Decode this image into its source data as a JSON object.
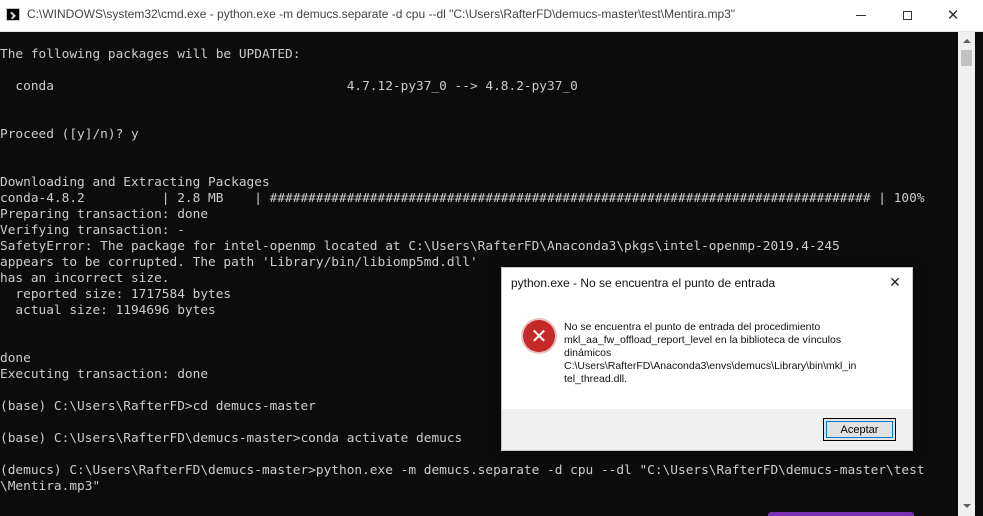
{
  "window": {
    "title": "C:\\WINDOWS\\system32\\cmd.exe - python.exe  -m demucs.separate -d cpu --dl \"C:\\Users\\RafterFD\\demucs-master\\test\\Mentira.mp3\"",
    "buttons": {
      "minimize": "minimize-icon",
      "maximize": "maximize-icon",
      "close": "close-icon"
    }
  },
  "console": {
    "lines": [
      "The following packages will be UPDATED:",
      "",
      "  conda                                      4.7.12-py37_0 --> 4.8.2-py37_0",
      "",
      "",
      "Proceed ([y]/n)? y",
      "",
      "",
      "Downloading and Extracting Packages",
      "conda-4.8.2          | 2.8 MB    | ############################################################################## | 100%",
      "Preparing transaction: done",
      "Verifying transaction: -",
      "SafetyError: The package for intel-openmp located at C:\\Users\\RafterFD\\Anaconda3\\pkgs\\intel-openmp-2019.4-245",
      "appears to be corrupted. The path 'Library/bin/libiomp5md.dll'",
      "has an incorrect size.",
      "  reported size: 1717584 bytes",
      "  actual size: 1194696 bytes",
      "",
      "",
      "done",
      "Executing transaction: done",
      "",
      "(base) C:\\Users\\RafterFD>cd demucs-master",
      "",
      "(base) C:\\Users\\RafterFD\\demucs-master>conda activate demucs",
      "",
      "(demucs) C:\\Users\\RafterFD\\demucs-master>python.exe -m demucs.separate -d cpu --dl \"C:\\Users\\RafterFD\\demucs-master\\test",
      "\\Mentira.mp3\""
    ],
    "colors": {
      "background": "#0c0c0c",
      "text": "#cccccc"
    }
  },
  "dialog": {
    "title": "python.exe - No se encuentra el punto de entrada",
    "icon": "error-icon",
    "icon_glyph": "✕",
    "message_lines": [
      "No se encuentra el punto de entrada del procedimiento",
      "mkl_aa_fw_offload_report_level en la biblioteca de vínculos",
      "dinámicos",
      "C:\\Users\\RafterFD\\Anaconda3\\envs\\demucs\\Library\\bin\\mkl_in",
      "tel_thread.dll."
    ],
    "ok_label": "Aceptar",
    "close_glyph": "✕",
    "colors": {
      "error_red": "#c52a2a",
      "focus_blue": "#0078d7"
    }
  }
}
